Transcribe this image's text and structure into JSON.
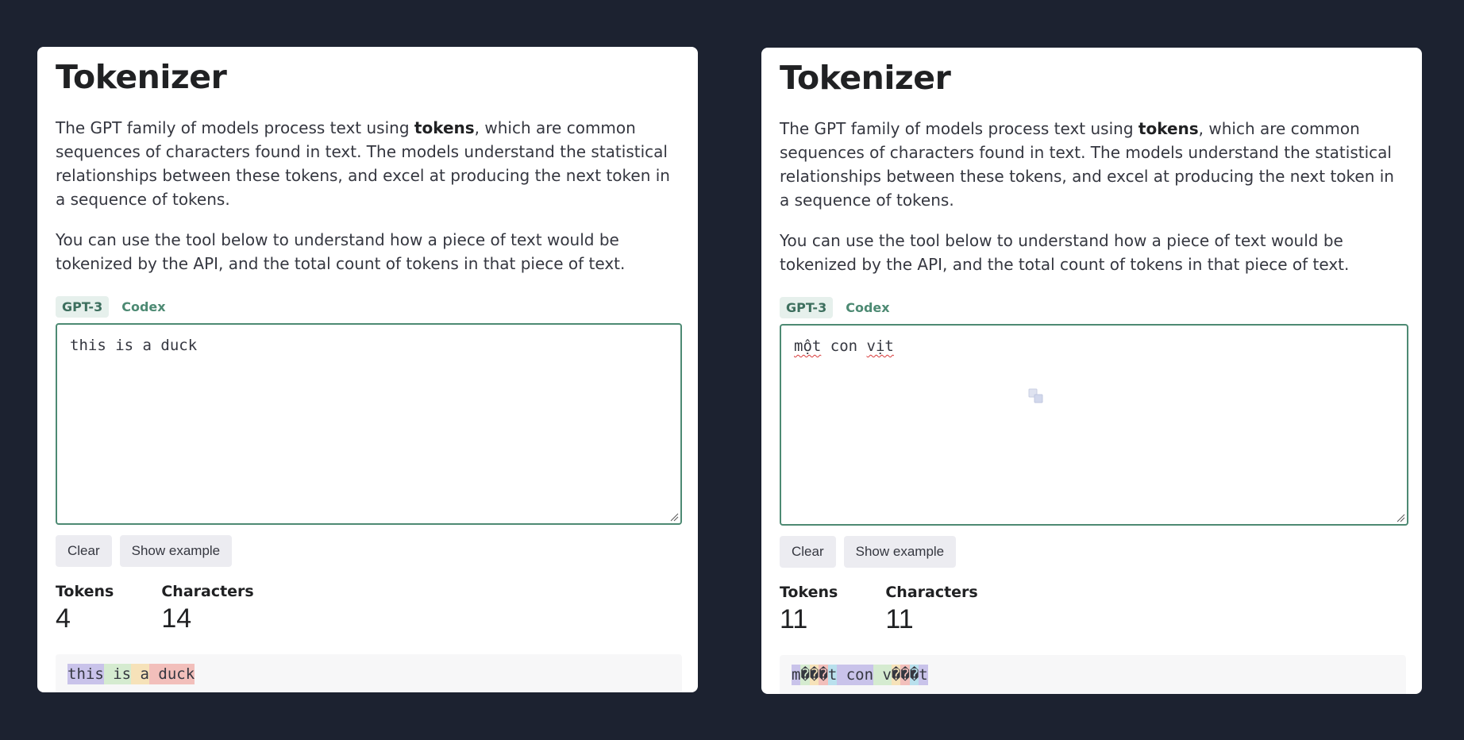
{
  "panels": [
    {
      "title": "Tokenizer",
      "intro_before": "The GPT family of models process text using ",
      "intro_bold": "tokens",
      "intro_after": ", which are common sequences of characters found in text. The models understand the statistical relationships between these tokens, and excel at producing the next token in a sequence of tokens.",
      "tool_text": "You can use the tool below to understand how a piece of text would be tokenized by the API, and the total count of tokens in that piece of text.",
      "model_tabs": [
        {
          "label": "GPT-3",
          "active": true
        },
        {
          "label": "Codex",
          "active": false
        }
      ],
      "input_text": "this is a duck",
      "buttons": {
        "clear": "Clear",
        "example": "Show example"
      },
      "stats": {
        "tokens_label": "Tokens",
        "tokens_value": "4",
        "characters_label": "Characters",
        "characters_value": "14"
      },
      "tokens": [
        {
          "text": "this",
          "color": "#c9c3ea"
        },
        {
          "text": " is",
          "color": "#d5ebd0"
        },
        {
          "text": " a",
          "color": "#f6e2b9"
        },
        {
          "text": " duck",
          "color": "#f2bfbb"
        }
      ]
    },
    {
      "title": "Tokenizer",
      "intro_before": "The GPT family of models process text using ",
      "intro_bold": "tokens",
      "intro_after": ", which are common sequences of characters found in text. The models understand the statistical relationships between these tokens, and excel at producing the next token in a sequence of tokens.",
      "tool_text": "You can use the tool below to understand how a piece of text would be tokenized by the API, and the total count of tokens in that piece of text.",
      "model_tabs": [
        {
          "label": "GPT-3",
          "active": true
        },
        {
          "label": "Codex",
          "active": false
        }
      ],
      "input_words": {
        "word1": "một",
        "word2": " con ",
        "word3": "vịt"
      },
      "buttons": {
        "clear": "Clear",
        "example": "Show example"
      },
      "stats": {
        "tokens_label": "Tokens",
        "tokens_value": "11",
        "characters_label": "Characters",
        "characters_value": "11"
      },
      "tokens": [
        {
          "text": "m",
          "color": "#c9c3ea"
        },
        {
          "text": "�",
          "color": "#d5ebd0"
        },
        {
          "text": "�",
          "color": "#f6e2b9"
        },
        {
          "text": "�",
          "color": "#f2bfbb"
        },
        {
          "text": "t",
          "color": "#b9e0ed"
        },
        {
          "text": " con",
          "color": "#c9c3ea"
        },
        {
          "text": " v",
          "color": "#d5ebd0"
        },
        {
          "text": "�",
          "color": "#f6e2b9"
        },
        {
          "text": "�",
          "color": "#f2bfbb"
        },
        {
          "text": "�",
          "color": "#b9e0ed"
        },
        {
          "text": "t",
          "color": "#c9c3ea"
        }
      ]
    }
  ]
}
